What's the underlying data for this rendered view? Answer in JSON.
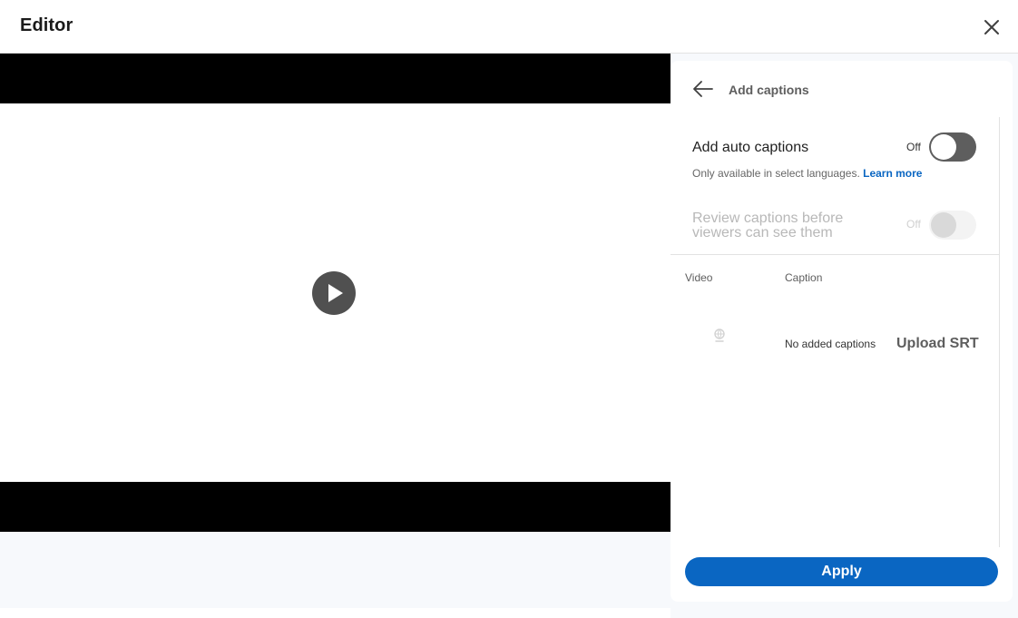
{
  "header": {
    "title": "Editor",
    "close_icon": "close-icon"
  },
  "video": {
    "play_icon": "play-icon"
  },
  "captions_panel": {
    "title": "Add captions",
    "back_icon": "arrow-left-icon",
    "auto_captions": {
      "label": "Add auto captions",
      "state": "Off",
      "enabled": false,
      "hint": "Only available in select languages.",
      "learn_more": "Learn more"
    },
    "review_captions": {
      "label": "Review captions before viewers can see them",
      "state": "Off",
      "enabled": false,
      "disabled": true
    },
    "table": {
      "columns": [
        "Video",
        "Caption"
      ],
      "rows": [
        {
          "video_icon": "language-globe-icon",
          "caption": "No added captions",
          "action": "Upload SRT"
        }
      ]
    },
    "apply_label": "Apply"
  },
  "colors": {
    "accent": "#0a66c2",
    "toggle_off": "#5e5e5e",
    "panel_bg": "#f7f9fc"
  }
}
